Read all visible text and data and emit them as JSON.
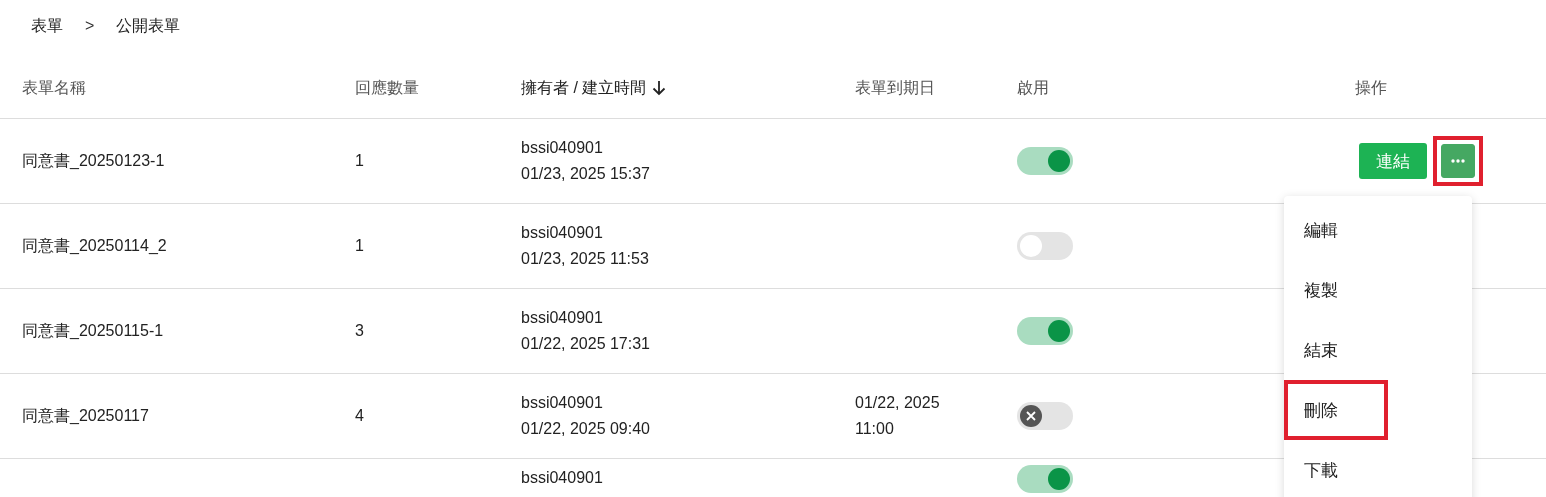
{
  "breadcrumb": {
    "items": [
      "表單",
      "公開表單"
    ],
    "separator": ">"
  },
  "table": {
    "columns": [
      {
        "label": "表單名稱",
        "sorted": false
      },
      {
        "label": "回應數量",
        "sorted": false
      },
      {
        "label": "擁有者 / 建立時間",
        "sorted": true
      },
      {
        "label": "表單到期日",
        "sorted": false
      },
      {
        "label": "啟用",
        "sorted": false
      },
      {
        "label": "操作",
        "sorted": false
      }
    ],
    "rows": [
      {
        "name": "同意書_20250123-1",
        "responses": "1",
        "owner": "bssi040901",
        "created": "01/23, 2025 15:37",
        "enabled": {
          "on": true,
          "locked": false
        },
        "link_label": "連結",
        "more_highlighted": true,
        "menu_open": true
      },
      {
        "name": "同意書_20250114_2",
        "responses": "1",
        "owner": "bssi040901",
        "created": "01/23, 2025 11:53",
        "enabled": {
          "on": false,
          "locked": false
        }
      },
      {
        "name": "同意書_20250115-1",
        "responses": "3",
        "owner": "bssi040901",
        "created": "01/22, 2025 17:31",
        "enabled": {
          "on": true,
          "locked": false
        }
      },
      {
        "name": "同意書_20250117",
        "responses": "4",
        "owner": "bssi040901",
        "created": "01/22, 2025 09:40",
        "expiry": "01/22, 2025 11:00",
        "enabled": {
          "on": false,
          "locked": true
        }
      },
      {
        "owner": "bssi040901",
        "enabled": {
          "on": true,
          "locked": false
        }
      }
    ]
  },
  "menu": {
    "items": [
      {
        "label": "編輯",
        "highlighted": false
      },
      {
        "label": "複製",
        "highlighted": false
      },
      {
        "label": "結束",
        "highlighted": false
      },
      {
        "label": "刪除",
        "highlighted": true
      },
      {
        "label": "下載",
        "highlighted": false
      }
    ]
  }
}
